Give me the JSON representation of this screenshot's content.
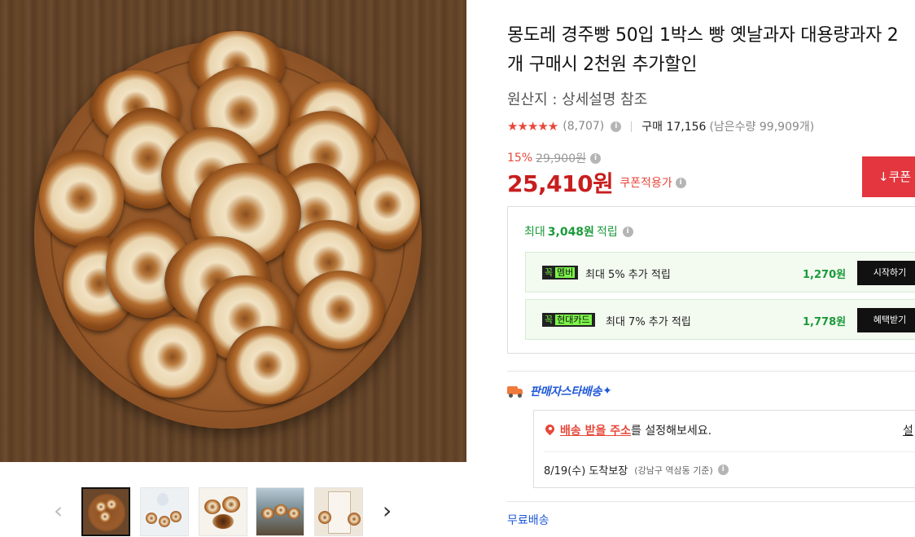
{
  "product": {
    "title": "몽도레 경주빵 50입 1박스 빵 옛날과자 대용량과자 2개 구매시 2천원 추가할인",
    "origin": "원산지 : 상세설명 참조"
  },
  "rating": {
    "stars_value": 4.5,
    "stars_glyph": "★★★★★",
    "review_count": "(8,707)",
    "purchase_label": "구매 17,156",
    "remaining": "(남은수량 99,909개)"
  },
  "price": {
    "discount_rate": "15%",
    "original_price": "29,900원",
    "sale_price": "25,410원",
    "coupon_note": "쿠폰적용가",
    "coupon_button": "↓쿠폰"
  },
  "rewards": {
    "header_prefix": "최대",
    "header_amount": "3,048원",
    "header_suffix": "적립",
    "benefits": [
      {
        "tag_prefix": "꼭",
        "tag_highlight": "멤버",
        "text": "최대 5% 추가 적립",
        "amount": "1,270원",
        "button": "시작하기"
      },
      {
        "tag_prefix": "꼭",
        "tag_highlight": "현대카드",
        "text": "최대 7% 추가 적립",
        "amount": "1,778원",
        "button": "혜택받기"
      }
    ]
  },
  "shipping": {
    "label": "판매자스타배송",
    "label_mark": "✦",
    "address_link": "배송 받을 주소",
    "address_rest": "를 설정해보세요.",
    "setup_link": "설",
    "eta": "8/19(수) 도착보장",
    "eta_sub": "(강남구 역삼동 기준)",
    "free_shipping": "무료배송"
  },
  "gallery": {
    "prev_icon": "‹",
    "next_icon": "›"
  },
  "colors": {
    "accent_red": "#e3363e",
    "price_red": "#c81e1e",
    "reward_green": "#1a9a3a",
    "shipping_blue": "#1f58d8"
  }
}
